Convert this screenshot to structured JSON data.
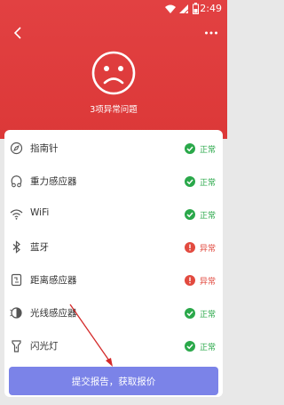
{
  "status_bar": {
    "time": "2:49"
  },
  "header": {
    "subtitle": "3项异常问题"
  },
  "checks": [
    {
      "label": "指南针",
      "status": "正常",
      "ok": true
    },
    {
      "label": "重力感应器",
      "status": "正常",
      "ok": true
    },
    {
      "label": "WiFi",
      "status": "正常",
      "ok": true
    },
    {
      "label": "蓝牙",
      "status": "异常",
      "ok": false
    },
    {
      "label": "距离感应器",
      "status": "异常",
      "ok": false
    },
    {
      "label": "光线感应器",
      "status": "正常",
      "ok": true
    },
    {
      "label": "闪光灯",
      "status": "正常",
      "ok": true
    }
  ],
  "submit_label": "提交报告，获取报价",
  "colors": {
    "header": "#e24142",
    "ok": "#2aa84a",
    "error": "#e24a3f",
    "button": "#7b83e8"
  }
}
